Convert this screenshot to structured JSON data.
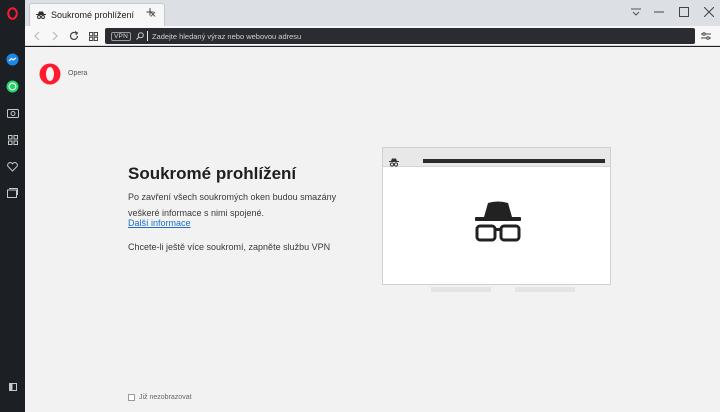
{
  "tab": {
    "label": "Soukromé prohlížení",
    "close": "×"
  },
  "newtab": "+",
  "toolbar": {
    "vpn_label": "VPN",
    "url_placeholder": "Zadejte hledaný výraz nebo webovou adresu"
  },
  "brand": {
    "name": "Opera",
    "color": "#ff1b2d"
  },
  "main": {
    "title": "Soukromé prohlížení",
    "description": "Po zavření všech soukromých oken budou smazány veškeré informace s nimi spojené.",
    "link": "Další informace",
    "vpn_hint": "Chcete-li ještě více soukromí, zapněte službu VPN"
  },
  "footer": {
    "checkbox_label": "Již nezobrazovat"
  },
  "sidebar": {
    "items": [
      {
        "icon": "messenger-icon",
        "color": "#1e88e5"
      },
      {
        "icon": "whatsapp-icon",
        "color": "#25d366"
      },
      {
        "icon": "camera-icon"
      },
      {
        "icon": "grid-icon"
      },
      {
        "icon": "heart-icon"
      },
      {
        "icon": "history-icon"
      }
    ]
  },
  "colors": {
    "link": "#1e6dc4",
    "accent": "#ff1b2d"
  }
}
